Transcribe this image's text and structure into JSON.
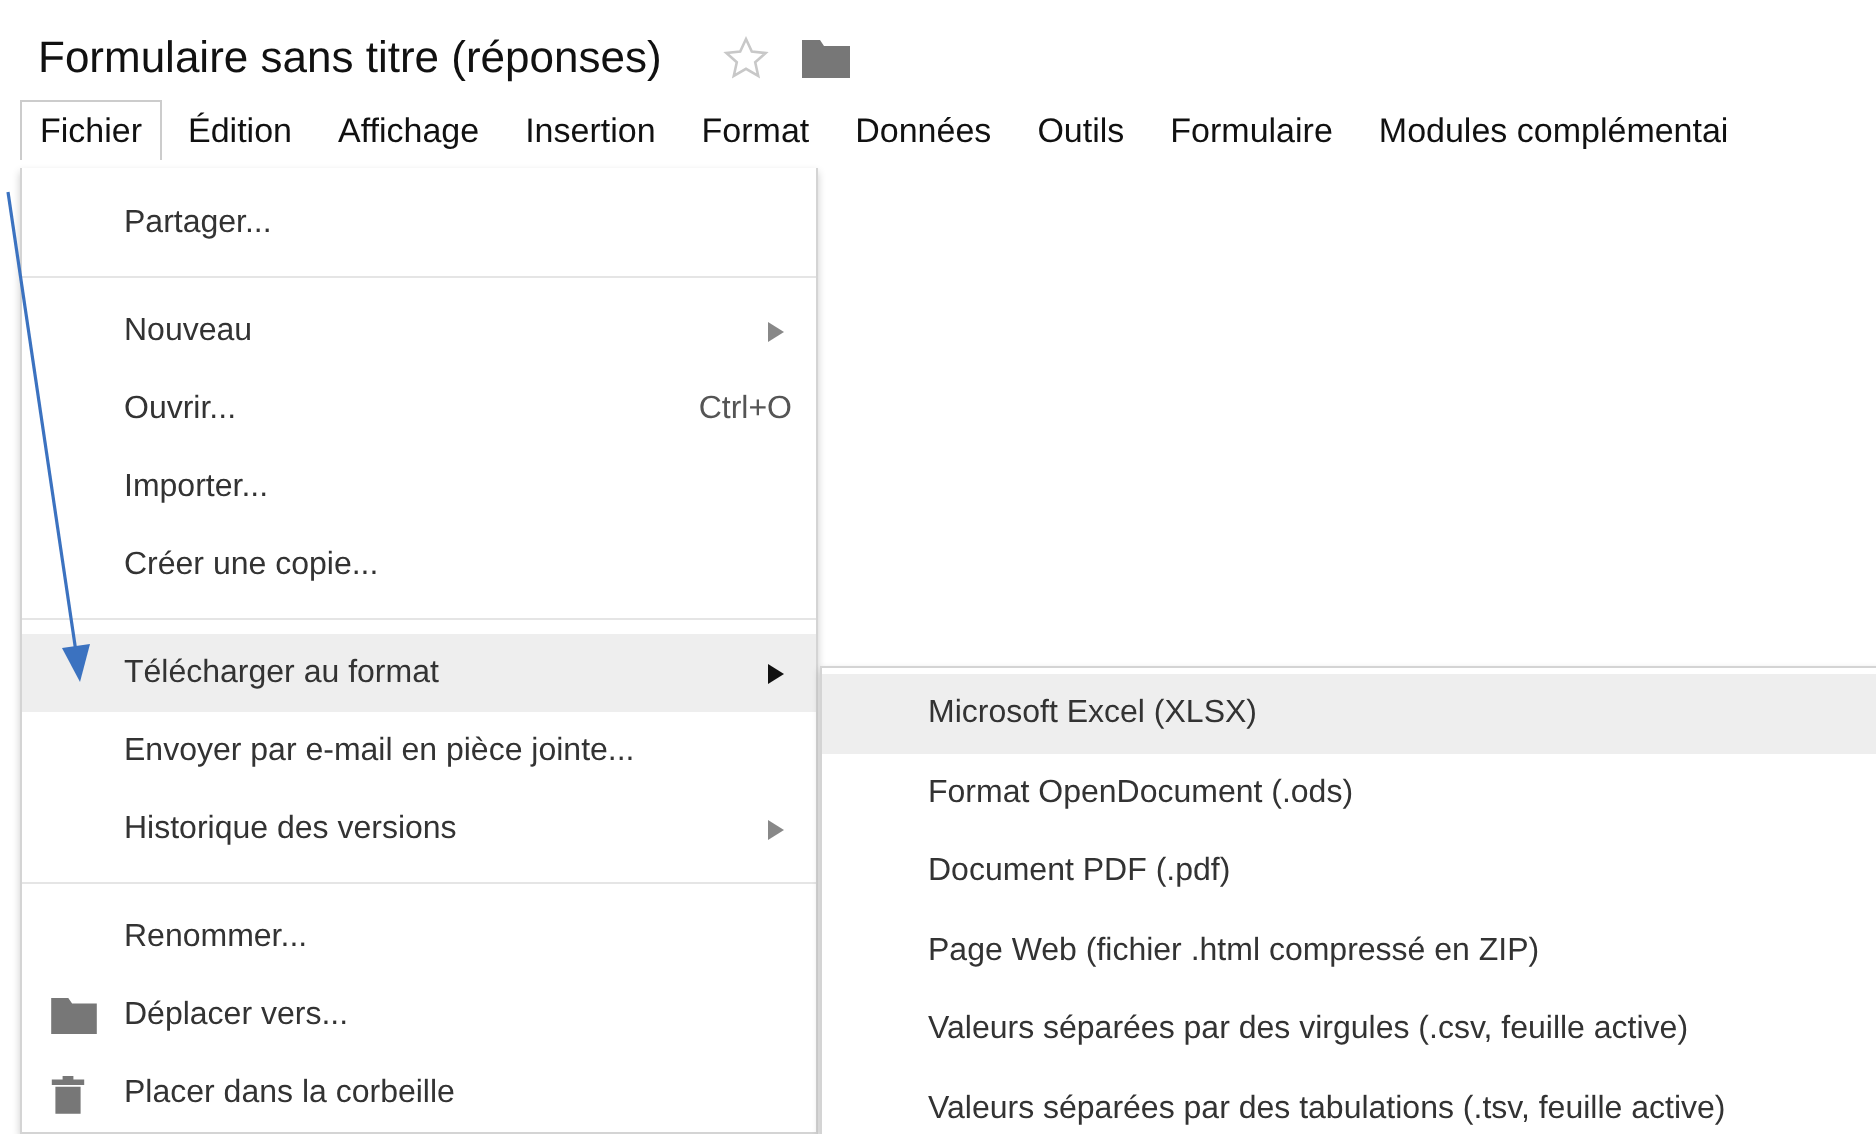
{
  "document": {
    "title": "Formulaire sans titre (réponses)",
    "starred": false
  },
  "menubar": [
    {
      "label": "Fichier",
      "selected": true
    },
    {
      "label": "Édition",
      "selected": false
    },
    {
      "label": "Affichage",
      "selected": false
    },
    {
      "label": "Insertion",
      "selected": false
    },
    {
      "label": "Format",
      "selected": false
    },
    {
      "label": "Données",
      "selected": false
    },
    {
      "label": "Outils",
      "selected": false
    },
    {
      "label": "Formulaire",
      "selected": false
    },
    {
      "label": "Modules complémentai",
      "selected": false
    }
  ],
  "file_menu": [
    {
      "kind": "item",
      "label": "Partager...",
      "submenu": false,
      "selected": false
    },
    {
      "kind": "separator"
    },
    {
      "kind": "item",
      "label": "Nouveau",
      "submenu": true,
      "selected": false
    },
    {
      "kind": "item",
      "label": "Ouvrir...",
      "shortcut": "Ctrl+O",
      "submenu": false,
      "selected": false
    },
    {
      "kind": "item",
      "label": "Importer...",
      "submenu": false,
      "selected": false
    },
    {
      "kind": "item",
      "label": "Créer une copie...",
      "submenu": false,
      "selected": false
    },
    {
      "kind": "separator"
    },
    {
      "kind": "item",
      "label": "Télécharger au format",
      "submenu": true,
      "selected": true
    },
    {
      "kind": "item",
      "label": "Envoyer par e-mail en pièce jointe...",
      "submenu": false,
      "selected": false
    },
    {
      "kind": "item",
      "label": "Historique des versions",
      "submenu": true,
      "selected": false
    },
    {
      "kind": "separator"
    },
    {
      "kind": "item",
      "label": "Renommer...",
      "submenu": false,
      "selected": false
    },
    {
      "kind": "folder",
      "label": "Déplacer vers...",
      "submenu": false,
      "selected": false
    },
    {
      "kind": "trash",
      "label": "Placer dans la corbeille",
      "submenu": false,
      "selected": false
    }
  ],
  "download_submenu": [
    {
      "label": "Microsoft Excel (XLSX)",
      "selected": true
    },
    {
      "label": "Format OpenDocument (.ods)",
      "selected": false
    },
    {
      "label": "Document PDF (.pdf)",
      "selected": false
    },
    {
      "label": "Page Web (fichier .html compressé en ZIP)",
      "selected": false
    },
    {
      "label": "Valeurs séparées par des virgules (.csv, feuille active)",
      "selected": false
    },
    {
      "label": "Valeurs séparées par des tabulations (.tsv, feuille active)",
      "selected": false
    }
  ]
}
